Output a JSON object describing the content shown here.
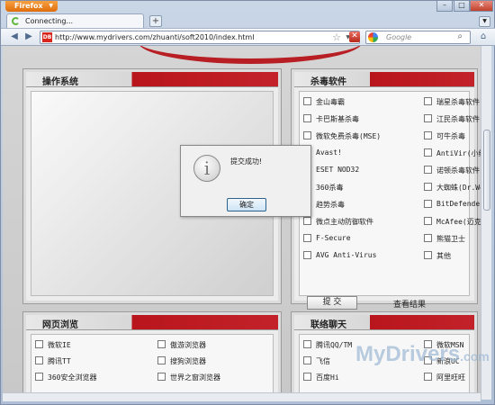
{
  "browser": {
    "menu_label": "Firefox",
    "tab_title": "Connecting...",
    "new_tab": "+",
    "url": "http://www.mydrivers.com/zhuanti/soft2010/index.html",
    "search_placeholder": "Google"
  },
  "panels": {
    "os": {
      "title": "操作系统"
    },
    "antivirus": {
      "title": "杀毒软件",
      "col1": [
        "金山毒霸",
        "卡巴斯基杀毒",
        "微软免费杀毒(MSE)",
        "Avast!",
        "ESET NOD32",
        "360杀毒",
        "趋势杀毒",
        "微点主动防御软件",
        "F-Secure",
        "AVG Anti-Virus"
      ],
      "col2": [
        "瑞星杀毒软件",
        "江民杀毒软件",
        "可牛杀毒",
        "AntiVir(小红",
        "诺顿杀毒软件",
        "大蜘蛛(Dr.We",
        "BitDefender",
        "McAfee(迈克",
        "熊猫卫士",
        "其他"
      ],
      "submit": "提 交",
      "view_results": "查看结果"
    },
    "browser": {
      "title": "网页浏览",
      "col1": [
        "微软IE",
        "腾讯TT",
        "360安全浏览器"
      ],
      "col2": [
        "傲游浏览器",
        "搜狗浏览器",
        "世界之窗浏览器"
      ]
    },
    "chat": {
      "title": "联络聊天",
      "col1": [
        "腾讯QQ/TM",
        "飞信",
        "百度Hi"
      ],
      "col2": [
        "微软MSN",
        "新浪UC",
        "阿里旺旺"
      ]
    }
  },
  "dialog": {
    "message": "提交成功!",
    "ok": "确定"
  },
  "watermark": {
    "text": "MyDrivers",
    "sub": ".com"
  }
}
